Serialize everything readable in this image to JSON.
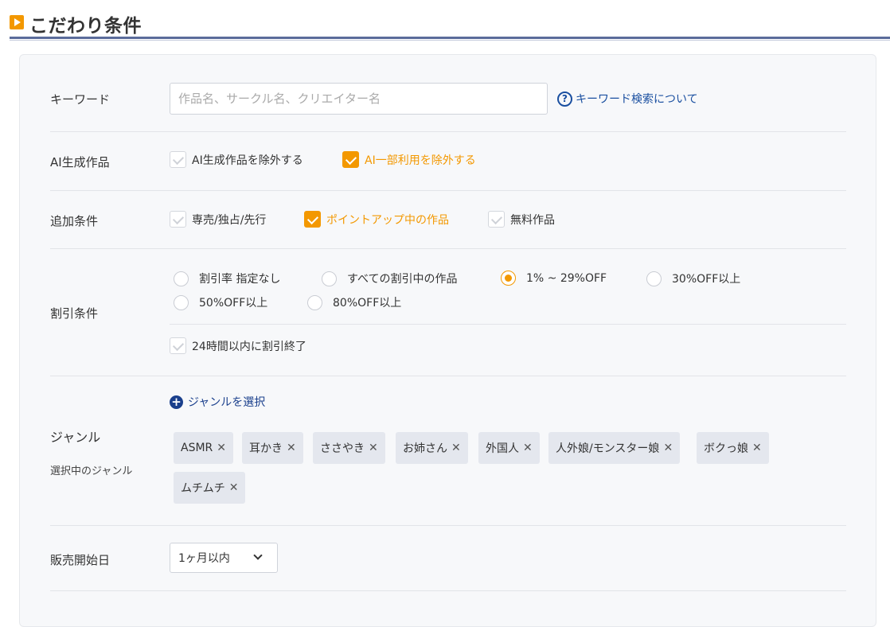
{
  "header": {
    "title": "こだわり条件"
  },
  "keyword": {
    "label": "キーワード",
    "placeholder": "作品名、サークル名、クリエイター名",
    "help_link": "キーワード検索について",
    "help_glyph": "?"
  },
  "ai": {
    "label": "AI生成作品",
    "options": [
      {
        "label": "AI生成作品を除外する",
        "checked": false
      },
      {
        "label": "AI一部利用を除外する",
        "checked": true
      }
    ]
  },
  "extra": {
    "label": "追加条件",
    "options": [
      {
        "label": "専売/独占/先行",
        "checked": false
      },
      {
        "label": "ポイントアップ中の作品",
        "checked": true
      },
      {
        "label": "無料作品",
        "checked": false
      }
    ]
  },
  "discount": {
    "label": "割引条件",
    "options": [
      {
        "label": "割引率 指定なし",
        "selected": false
      },
      {
        "label": "すべての割引中の作品",
        "selected": false
      },
      {
        "label": "1% ~ 29%OFF",
        "selected": true
      },
      {
        "label": "30%OFF以上",
        "selected": false
      },
      {
        "label": "50%OFF以上",
        "selected": false
      },
      {
        "label": "80%OFF以上",
        "selected": false
      }
    ],
    "ending": {
      "label": "24時間以内に割引終了",
      "checked": false
    }
  },
  "genre": {
    "label": "ジャンル",
    "sub_label": "選択中のジャンル",
    "add_label": "ジャンルを選択",
    "add_glyph": "+",
    "remove_glyph": "✕",
    "tags": [
      "ASMR",
      "耳かき",
      "ささやき",
      "お姉さん",
      "外国人",
      "人外娘/モンスター娘",
      "ボクっ娘",
      "ムチムチ"
    ]
  },
  "release": {
    "label": "販売開始日",
    "selected": "1ヶ月以内"
  },
  "colors": {
    "accent": "#f39800",
    "link": "#1a4fa0",
    "rule": "#5a6b9a"
  }
}
